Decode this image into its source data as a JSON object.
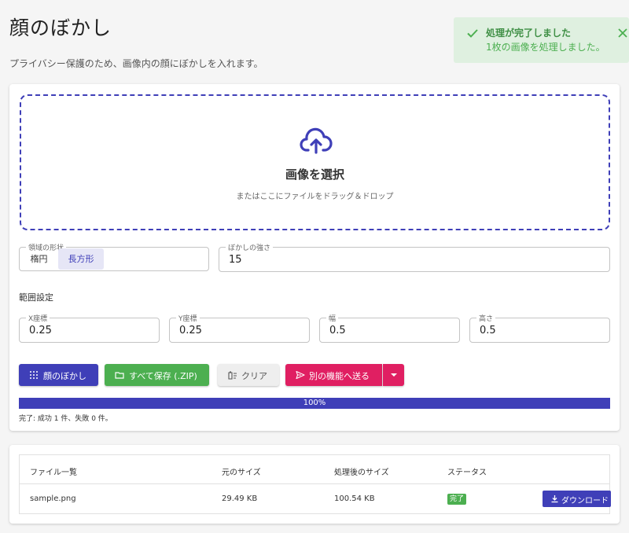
{
  "page": {
    "title": "顔のぼかし",
    "subtitle": "プライバシー保護のため、画像内の顔にぼかしを入れます。"
  },
  "toast": {
    "title": "処理が完了しました",
    "message": "1枚の画像を処理しました。",
    "icon": "check-icon",
    "color": "#4caf50"
  },
  "upload": {
    "title": "画像を選択",
    "hint": "またはここにファイルをドラッグ＆ドロップ",
    "icon": "cloud-upload-icon"
  },
  "shape": {
    "label": "領域の形状",
    "options": [
      "楕円",
      "長方形"
    ],
    "selected": "長方形"
  },
  "strength": {
    "label": "ぼかしの強さ",
    "value": "15"
  },
  "range": {
    "label": "範囲設定",
    "x": {
      "label": "X座標",
      "value": "0.25"
    },
    "y": {
      "label": "Y座標",
      "value": "0.25"
    },
    "width": {
      "label": "幅",
      "value": "0.5"
    },
    "height": {
      "label": "高さ",
      "value": "0.5"
    }
  },
  "actions": {
    "blur": "顔のぼかし",
    "save_all": "すべて保存 (.ZIP)",
    "clear": "クリア",
    "send": "別の機能へ送る"
  },
  "progress": {
    "percent": 100,
    "text": "100%",
    "status": "完了: 成功 1 件、失敗 0 件。"
  },
  "table": {
    "headers": [
      "ファイル一覧",
      "元のサイズ",
      "処理後のサイズ",
      "ステータス"
    ],
    "rows": [
      {
        "file": "sample.png",
        "original_size": "29.49 KB",
        "processed_size": "100.54 KB",
        "status": "完了",
        "download": "ダウンロード"
      }
    ]
  },
  "colors": {
    "primary": "#3f3fb8",
    "success": "#4caf50",
    "accent": "#e01f62"
  }
}
